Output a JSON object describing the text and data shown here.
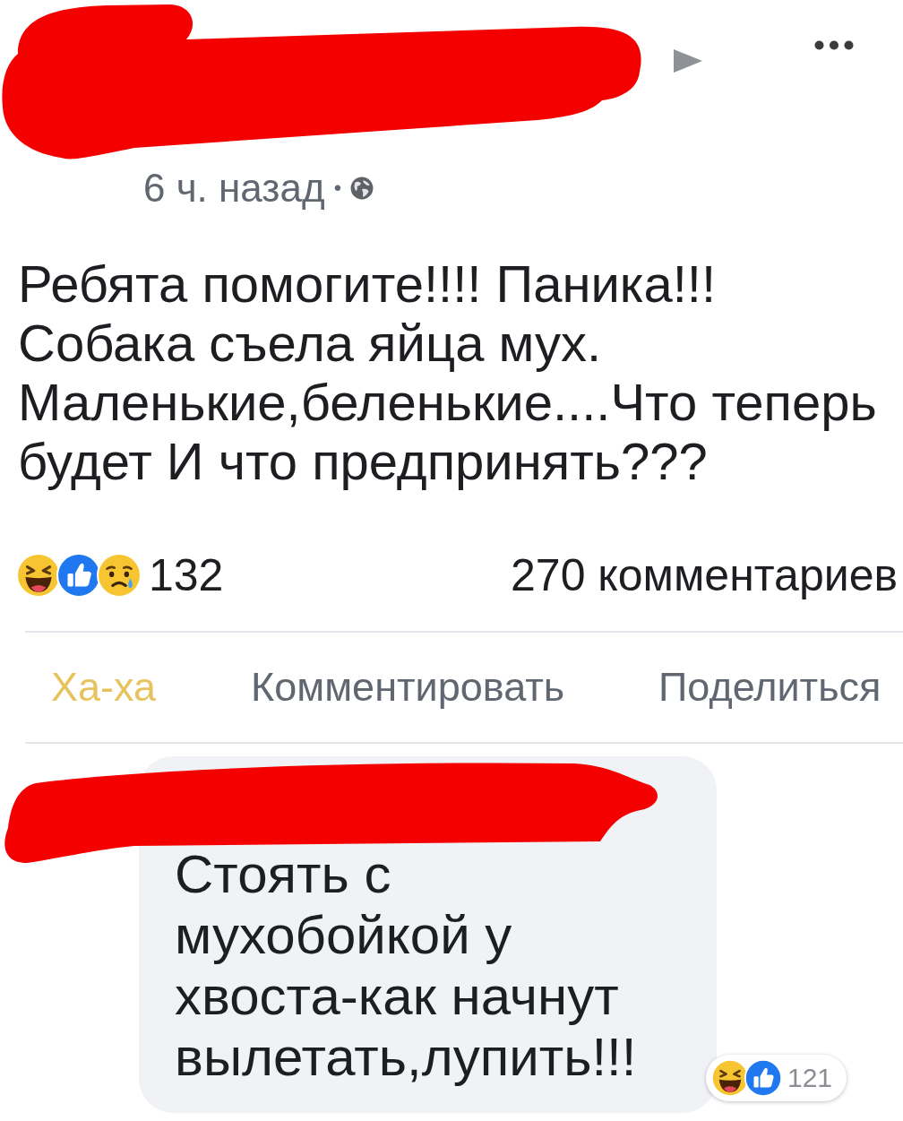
{
  "post": {
    "time": "6 ч. назад",
    "separator": "•",
    "text": "Ребята помогите!!!! Паника!!!\nСобака съела яйца мух.\nМаленькие,беленькие....Что теперь\nбудет И что предпринять???"
  },
  "reactions_bar": {
    "count": "132",
    "comments": "270 комментариев"
  },
  "actions": [
    {
      "label": "Ха-ха",
      "selected": true
    },
    {
      "label": "Комментировать",
      "selected": false
    },
    {
      "label": "Поделиться",
      "selected": false
    }
  ],
  "comment": {
    "text": "Стоять с\nмухобойкой у\nхвоста-как начнут\nвылетать,лупить!!!",
    "reaction_count": "121"
  }
}
